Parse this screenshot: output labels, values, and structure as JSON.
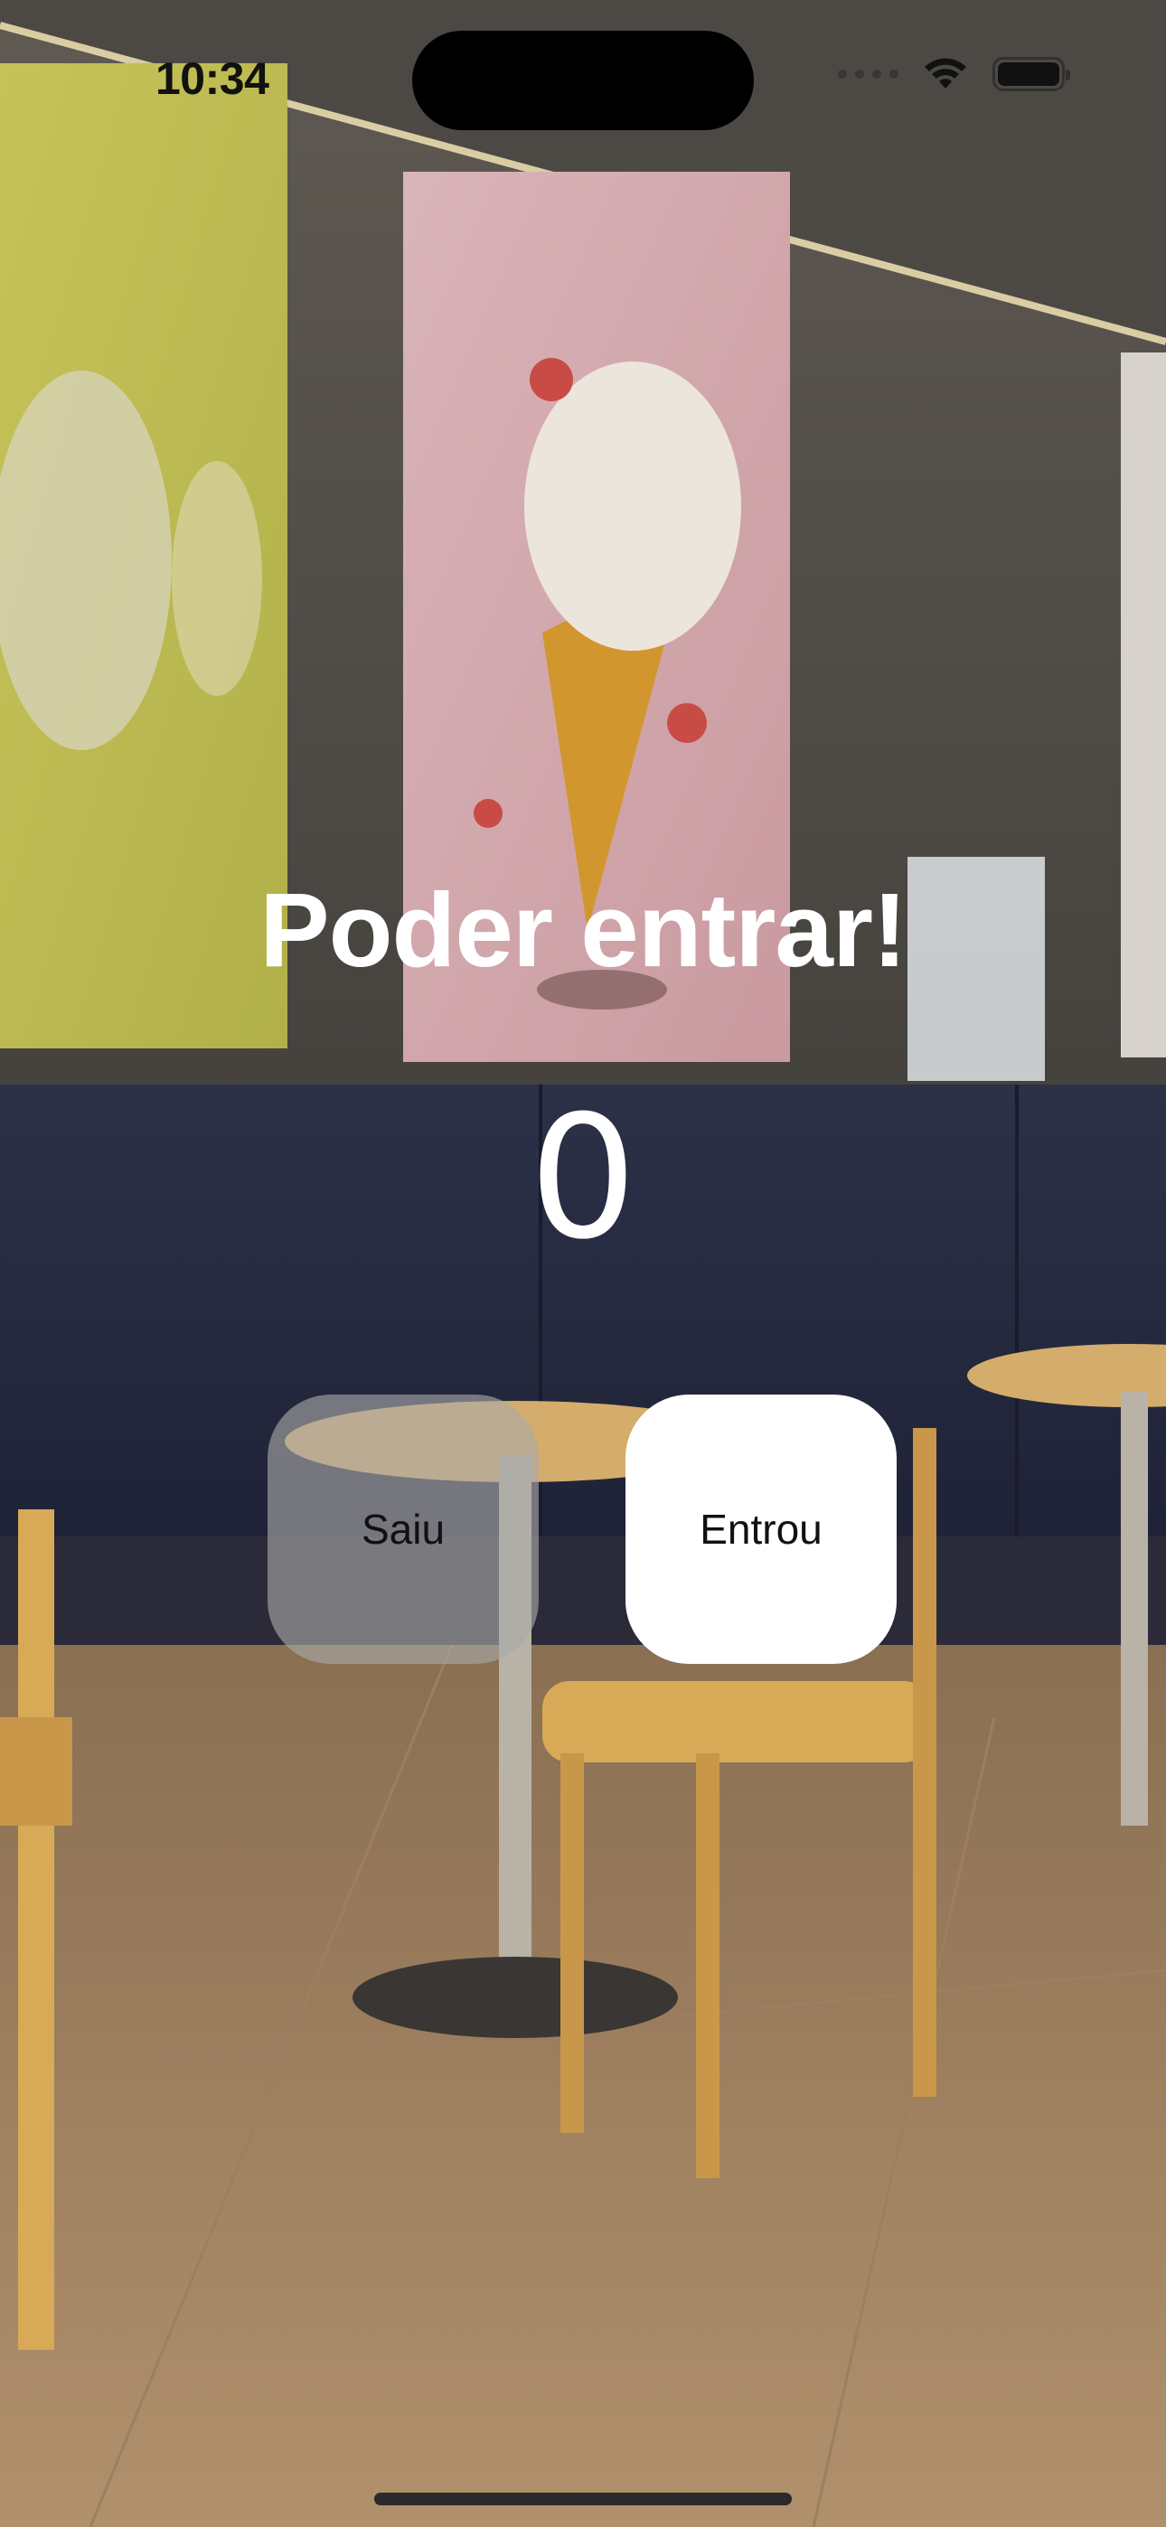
{
  "status_bar": {
    "time": "10:34",
    "wifi_icon": "wifi-icon",
    "battery_icon": "battery-icon"
  },
  "main": {
    "title": "Poder entrar!",
    "count": "0",
    "buttons": {
      "left_label": "Saiu",
      "right_label": "Entrou"
    }
  },
  "colors": {
    "title": "#ffffff",
    "button_primary": "#ffffff",
    "button_secondary": "rgba(170,170,170,0.62)"
  },
  "background": "ice cream shop interior photo with cone poster, navy bench and wooden chairs"
}
